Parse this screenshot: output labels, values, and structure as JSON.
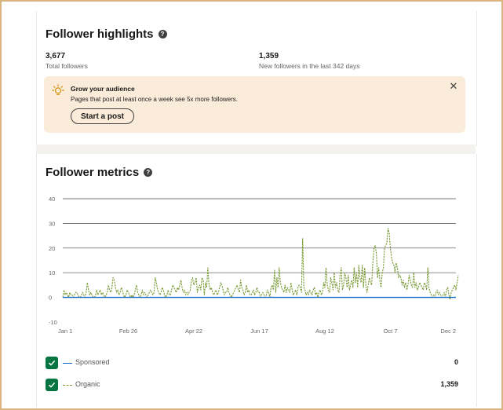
{
  "highlights": {
    "title": "Follower highlights",
    "total_value": "3,677",
    "total_label": "Total followers",
    "new_value": "1,359",
    "new_label": "New followers in the last 342 days"
  },
  "banner": {
    "title": "Grow your audience",
    "text": "Pages that post at least once a week see 5x more followers.",
    "button_label": "Start a post",
    "close_symbol": "✕",
    "icon": "lightbulb-icon",
    "background": "#fbecd9"
  },
  "metrics": {
    "title": "Follower metrics",
    "legend": [
      {
        "label": "Sponsored",
        "value": "0",
        "color": "#0a66c2",
        "style": "solid",
        "checked": true
      },
      {
        "label": "Organic",
        "value": "1,359",
        "color": "#7a9a35",
        "style": "dashed",
        "checked": true
      }
    ]
  },
  "chart_data": {
    "type": "line",
    "x_tick_labels": [
      "Jan 1",
      "Feb 26",
      "Apr 22",
      "Jun 17",
      "Aug 12",
      "Oct 7",
      "Dec 2"
    ],
    "y_ticks": [
      -10,
      0,
      10,
      20,
      30,
      40
    ],
    "ylim": [
      -10,
      40
    ],
    "grid": true,
    "x_count": 337,
    "series": [
      {
        "name": "Sponsored",
        "color": "#0a66c2",
        "style": "solid",
        "values": [
          0
        ]
      },
      {
        "name": "Organic",
        "color": "#7a9a35",
        "style": "dashed",
        "values": [
          0,
          3,
          1,
          2,
          1,
          0,
          2,
          1,
          1,
          0,
          1,
          2,
          2,
          1,
          0,
          0,
          1,
          2,
          1,
          0,
          2,
          6,
          3,
          1,
          2,
          1,
          0,
          0,
          1,
          3,
          1,
          2,
          3,
          1,
          2,
          1,
          0,
          1,
          2,
          5,
          3,
          2,
          4,
          8,
          7,
          4,
          2,
          3,
          1,
          2,
          4,
          3,
          1,
          0,
          1,
          3,
          2,
          1,
          0,
          1,
          0,
          1,
          3,
          5,
          2,
          1,
          0,
          1,
          3,
          1,
          2,
          1,
          0,
          1,
          2,
          3,
          2,
          1,
          2,
          8,
          6,
          3,
          2,
          1,
          2,
          4,
          3,
          1,
          0,
          1,
          3,
          1,
          1,
          3,
          5,
          4,
          3,
          2,
          4,
          3,
          5,
          7,
          4,
          2,
          3,
          1,
          2,
          1,
          2,
          3,
          7,
          8,
          5,
          6,
          8,
          2,
          4,
          5,
          3,
          8,
          7,
          1,
          6,
          4,
          12,
          5,
          3,
          4,
          2,
          1,
          2,
          3,
          1,
          2,
          4,
          6,
          5,
          3,
          1,
          2,
          2,
          4,
          2,
          1,
          0,
          1,
          2,
          3,
          4,
          5,
          3,
          2,
          7,
          4,
          3,
          1,
          2,
          5,
          2,
          3,
          1,
          1,
          2,
          3,
          1,
          2,
          4,
          2,
          2,
          0,
          1,
          2,
          1,
          0,
          1,
          3,
          2,
          0,
          4,
          5,
          3,
          11,
          2,
          8,
          4,
          12,
          6,
          4,
          3,
          2,
          5,
          2,
          4,
          3,
          2,
          6,
          3,
          1,
          2,
          3,
          1,
          4,
          5,
          4,
          2,
          24,
          4,
          3,
          1,
          2,
          1,
          3,
          2,
          1,
          3,
          4,
          1,
          2,
          0,
          2,
          3,
          1,
          2,
          6,
          4,
          12,
          5,
          3,
          2,
          8,
          6,
          3,
          10,
          4,
          6,
          3,
          2,
          9,
          12,
          3,
          5,
          10,
          8,
          4,
          9,
          3,
          5,
          7,
          4,
          12,
          6,
          10,
          4,
          13,
          8,
          6,
          13,
          4,
          12,
          5,
          2,
          5,
          8,
          6,
          5,
          14,
          20,
          21,
          18,
          8,
          12,
          7,
          4,
          10,
          12,
          20,
          21,
          22,
          28,
          26,
          20,
          16,
          14,
          13,
          10,
          14,
          12,
          8,
          9,
          8,
          5,
          7,
          4,
          6,
          3,
          5,
          9,
          7,
          5,
          4,
          10,
          4,
          6,
          3,
          4,
          6,
          5,
          4,
          3,
          6,
          5,
          3,
          12,
          4,
          2,
          1,
          0,
          1,
          0,
          2,
          3,
          1,
          2,
          1,
          0,
          1,
          2,
          0,
          3,
          4,
          1,
          -1,
          2,
          3,
          4,
          5,
          3,
          6,
          9
        ]
      }
    ]
  }
}
